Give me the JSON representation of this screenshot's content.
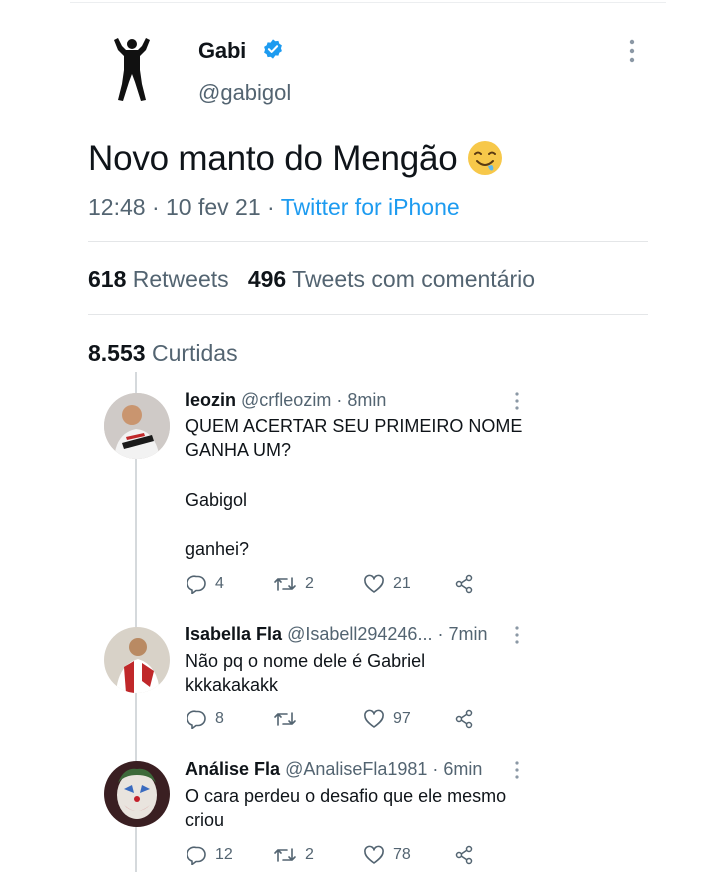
{
  "tweet": {
    "author_name": "Gabi",
    "author_handle": "@gabigol",
    "text": "Novo manto do Mengão",
    "time": "12:48",
    "date": "10 fev 21",
    "source": "Twitter for iPhone",
    "retweets_count": "618",
    "retweets_label": "Retweets",
    "quote_count": "496",
    "quote_label": "Tweets com comentário",
    "likes_count": "8.553",
    "likes_label": "Curtidas"
  },
  "colors": {
    "accent": "#1d9bf0",
    "secondary_text": "#536471",
    "primary_text": "#0f1419"
  },
  "replies": [
    {
      "name": "leozin",
      "handle": "@crfleozim",
      "time": "8min",
      "lines": [
        "QUEM ACERTAR SEU PRIMEIRO NOME",
        "GANHA UM?",
        "Gabigol",
        "ganhei?"
      ],
      "replies": "4",
      "retweets": "2",
      "likes": "21"
    },
    {
      "name": "Isabella Fla",
      "handle": "@Isabell294246...",
      "time": "7min",
      "lines": [
        "Não pq o nome dele é Gabriel",
        "kkkakakakk"
      ],
      "replies": "8",
      "retweets": "",
      "likes": "97"
    },
    {
      "name": "Análise Fla",
      "handle": "@AnaliseFla1981",
      "time": "6min",
      "lines": [
        "O cara perdeu o desafio que ele mesmo",
        "criou"
      ],
      "replies": "12",
      "retweets": "2",
      "likes": "78"
    }
  ],
  "icons": [
    "verified-badge-icon",
    "more-options-icon",
    "reply-icon",
    "retweet-icon",
    "like-icon",
    "share-icon"
  ]
}
